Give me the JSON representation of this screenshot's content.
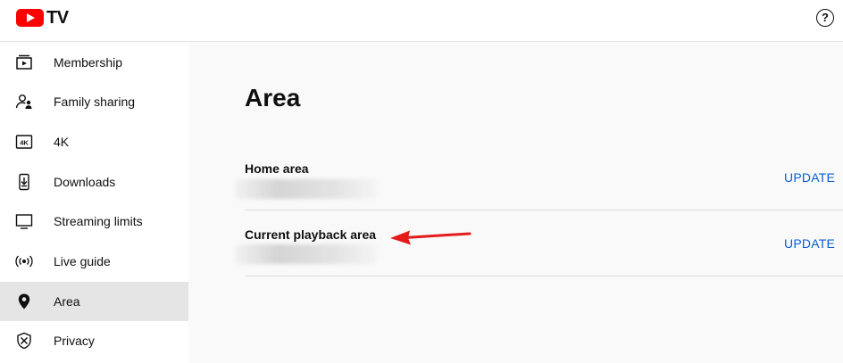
{
  "header": {
    "logo_text": "TV",
    "help_label": "?"
  },
  "sidebar": {
    "items": [
      {
        "label": "Membership",
        "icon": "membership-icon"
      },
      {
        "label": "Family sharing",
        "icon": "family-sharing-icon"
      },
      {
        "label": "4K",
        "icon": "4k-icon",
        "badge": "4K"
      },
      {
        "label": "Downloads",
        "icon": "downloads-icon"
      },
      {
        "label": "Streaming limits",
        "icon": "monitor-icon"
      },
      {
        "label": "Live guide",
        "icon": "live-guide-icon"
      },
      {
        "label": "Area",
        "icon": "location-pin-icon",
        "active": true
      },
      {
        "label": "Privacy",
        "icon": "shield-icon"
      }
    ]
  },
  "main": {
    "title": "Area",
    "rows": [
      {
        "label": "Home area",
        "action": "UPDATE"
      },
      {
        "label": "Current playback area",
        "action": "UPDATE"
      }
    ]
  },
  "colors": {
    "brand": "#ff0000",
    "link": "#065fd4",
    "active_bg": "#e5e5e5",
    "annotation_arrow": "#e31b1b"
  }
}
